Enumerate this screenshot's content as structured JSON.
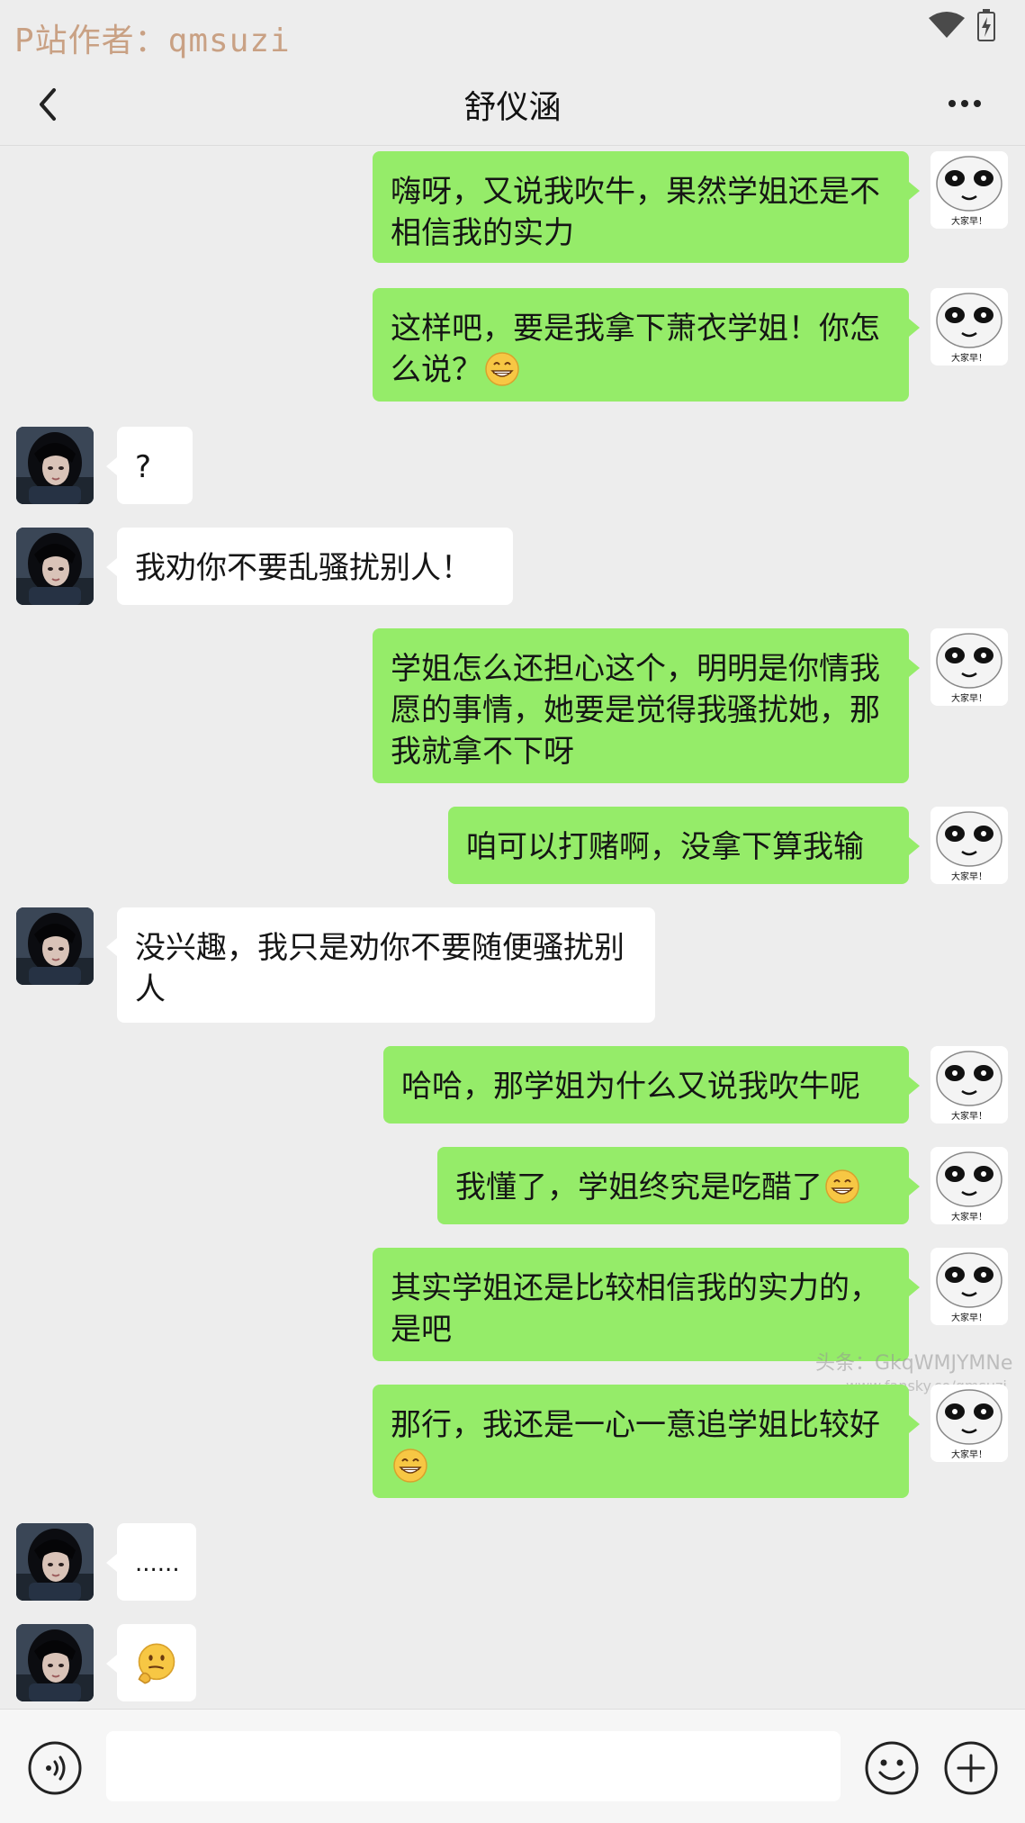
{
  "status_bar": {
    "watermark": "P站作者：qmsuzi",
    "wifi_icon": "wifi-icon",
    "battery_icon": "battery-icon"
  },
  "header": {
    "title": "舒仪涵",
    "back_icon": "back-chevron-icon",
    "more_icon": "more-dots-icon"
  },
  "self_avatar_caption": "大家早！",
  "messages": [
    {
      "from": "self",
      "text": "嗨呀，又说我吹牛，果然学姐还是不相信我的实力"
    },
    {
      "from": "self",
      "text": "这样吧，要是我拿下萧衣学姐！你怎么说？",
      "emoji": "grin-emoji"
    },
    {
      "from": "peer",
      "text": "?"
    },
    {
      "from": "peer",
      "text": "我劝你不要乱骚扰别人！"
    },
    {
      "from": "self",
      "text": "学姐怎么还担心这个，明明是你情我愿的事情，她要是觉得我骚扰她，那我就拿不下呀"
    },
    {
      "from": "self",
      "text": "咱可以打赌啊，没拿下算我输"
    },
    {
      "from": "peer",
      "text": "没兴趣，我只是劝你不要随便骚扰别人"
    },
    {
      "from": "self",
      "text": "哈哈，那学姐为什么又说我吹牛呢"
    },
    {
      "from": "self",
      "text": "我懂了，学姐终究是吃醋了",
      "emoji": "grin-emoji"
    },
    {
      "from": "self",
      "text": "其实学姐还是比较相信我的实力的，是吧"
    },
    {
      "from": "self",
      "text": "那行，我还是一心一意追学姐比较好",
      "emoji": "grin-emoji"
    },
    {
      "from": "peer",
      "text": "......"
    },
    {
      "from": "peer",
      "text": "",
      "emoji": "thinking-emoji"
    }
  ],
  "overlay_watermark": {
    "line1": "头条：GkqWMJYMNe",
    "line2": "www.fansky.co/qmsuzi"
  },
  "input_bar": {
    "voice_icon": "voice-icon",
    "message_value": "",
    "emoji_icon": "emoji-icon",
    "add_icon": "plus-icon"
  },
  "colors": {
    "self_bubble": "#95ec69",
    "peer_bubble": "#ffffff",
    "background": "#ededed"
  }
}
